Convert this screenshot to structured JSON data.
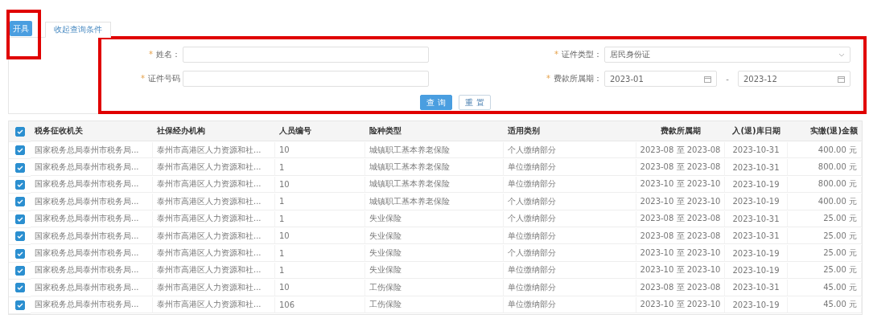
{
  "toolbar": {
    "issue_button": "开具",
    "tabs": [
      {
        "label": "收起查询条件",
        "selected": true
      }
    ]
  },
  "query_form": {
    "fields": [
      {
        "kind": "text",
        "mark": "*",
        "label": "姓名："
      },
      {
        "kind": "select",
        "mark": "*",
        "label": "证件类型：",
        "value": "居民身份证"
      },
      {
        "kind": "text",
        "mark": "*",
        "label": "证件号码"
      },
      {
        "kind": "daterange",
        "mark": "*",
        "label": "费款所属期：",
        "from": "2023-01",
        "separator": "-",
        "to": "2023-12"
      }
    ],
    "buttons": [
      {
        "label": "查 询",
        "primary": true
      },
      {
        "label": "重 置",
        "primary": false
      }
    ]
  },
  "table": {
    "all_checked": true,
    "columns": [
      {
        "label": "税务征收机关",
        "kind": "text"
      },
      {
        "label": "社保经办机构",
        "kind": "text"
      },
      {
        "label": "人员编号",
        "kind": "text"
      },
      {
        "label": "险种类型",
        "kind": "text"
      },
      {
        "label": "适用类别",
        "kind": "text"
      },
      {
        "label": "费款所属期",
        "kind": "center"
      },
      {
        "label": "入(退)库日期",
        "kind": "center"
      },
      {
        "label": "实缴(退)金额",
        "kind": "amount"
      }
    ],
    "rows": [
      {
        "checked": true,
        "cells": [
          "国家税务总局泰州市税务局...",
          "泰州市高港区人力资源和社...",
          "10",
          "城镇职工基本养老保险",
          "个人缴纳部分",
          "2023-08 至 2023-08",
          "2023-10-31",
          "400.00 元"
        ]
      },
      {
        "checked": true,
        "cells": [
          "国家税务总局泰州市税务局...",
          "泰州市高港区人力资源和社...",
          "1",
          "城镇职工基本养老保险",
          "单位缴纳部分",
          "2023-08 至 2023-08",
          "2023-10-31",
          "800.00 元"
        ]
      },
      {
        "checked": true,
        "cells": [
          "国家税务总局泰州市税务局...",
          "泰州市高港区人力资源和社...",
          "10",
          "城镇职工基本养老保险",
          "单位缴纳部分",
          "2023-10 至 2023-10",
          "2023-10-19",
          "800.00 元"
        ]
      },
      {
        "checked": true,
        "cells": [
          "国家税务总局泰州市税务局...",
          "泰州市高港区人力资源和社...",
          "1",
          "城镇职工基本养老保险",
          "个人缴纳部分",
          "2023-10 至 2023-10",
          "2023-10-19",
          "400.00 元"
        ]
      },
      {
        "checked": true,
        "cells": [
          "国家税务总局泰州市税务局...",
          "泰州市高港区人力资源和社...",
          "1",
          "失业保险",
          "个人缴纳部分",
          "2023-08 至 2023-08",
          "2023-10-31",
          "25.00 元"
        ]
      },
      {
        "checked": true,
        "cells": [
          "国家税务总局泰州市税务局...",
          "泰州市高港区人力资源和社...",
          "10",
          "失业保险",
          "单位缴纳部分",
          "2023-08 至 2023-08",
          "2023-10-31",
          "25.00 元"
        ]
      },
      {
        "checked": true,
        "cells": [
          "国家税务总局泰州市税务局...",
          "泰州市高港区人力资源和社...",
          "1",
          "失业保险",
          "个人缴纳部分",
          "2023-10 至 2023-10",
          "2023-10-19",
          "25.00 元"
        ]
      },
      {
        "checked": true,
        "cells": [
          "国家税务总局泰州市税务局...",
          "泰州市高港区人力资源和社...",
          "1",
          "失业保险",
          "单位缴纳部分",
          "2023-10 至 2023-10",
          "2023-10-19",
          "25.00 元"
        ]
      },
      {
        "checked": true,
        "cells": [
          "国家税务总局泰州市税务局...",
          "泰州市高港区人力资源和社...",
          "10",
          "工伤保险",
          "单位缴纳部分",
          "2023-08 至 2023-08",
          "2023-10-31",
          "45.00 元"
        ]
      },
      {
        "checked": true,
        "cells": [
          "国家税务总局泰州市税务局...",
          "泰州市高港区人力资源和社...",
          "106",
          "工伤保险",
          "单位缴纳部分",
          "2023-10 至 2023-10",
          "2023-10-19",
          "45.00 元"
        ]
      }
    ]
  }
}
